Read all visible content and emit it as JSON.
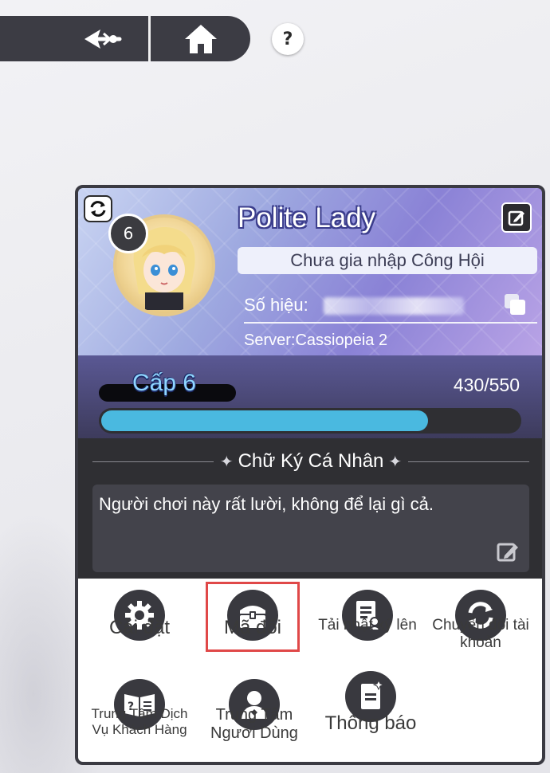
{
  "topbar": {
    "back_icon": "back-arrow-icon",
    "home_icon": "home-icon",
    "help_label": "?"
  },
  "profile": {
    "level_badge": "6",
    "name": "Polite Lady",
    "guild": "Chưa gia nhập Công Hội",
    "id_label": "Số hiệu:",
    "server": "Server:Cassiopeia 2"
  },
  "level": {
    "label": "Cấp 6",
    "exp_text": "430/550",
    "exp_current": 430,
    "exp_max": 550
  },
  "signature": {
    "title": "Chữ Ký Cá Nhân",
    "text": "Người chơi này rất lười, không để lại gì cả."
  },
  "menu": {
    "items": [
      {
        "label": "Cài đặt",
        "icon": "gear-icon"
      },
      {
        "label": "Mã đổi",
        "icon": "treasure-chest-icon"
      },
      {
        "label": "Tải nhật ký lên",
        "icon": "upload-log-icon"
      },
      {
        "label": "Chuyển đổi tài khoản",
        "icon": "switch-account-icon"
      },
      {
        "label": "Trung Tâm Dịch Vụ Khách Hàng",
        "icon": "customer-service-book-icon"
      },
      {
        "label": "Trung Tâm Người Dùng",
        "icon": "user-center-icon"
      },
      {
        "label": "Thông báo",
        "icon": "notice-icon"
      }
    ]
  },
  "colors": {
    "highlight": "#e04848",
    "exp_fill": "#4ab9e0",
    "panel_dark": "#2d2d33"
  }
}
